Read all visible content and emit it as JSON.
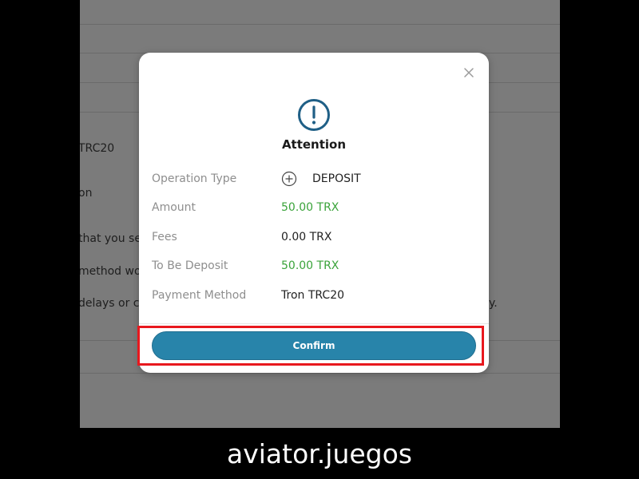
{
  "background": {
    "fragments": [
      "TRC20",
      "on",
      "that you se",
      "method wo",
      "delays or c",
      "y."
    ]
  },
  "modal": {
    "title": "Attention",
    "icons": {
      "close": "close-icon",
      "alert": "exclamation-circle-icon",
      "plus": "plus-circle-icon"
    },
    "rows": [
      {
        "label": "Operation Type",
        "value": "DEPOSIT"
      },
      {
        "label": "Amount",
        "value": "50.00 TRX"
      },
      {
        "label": "Fees",
        "value": "0.00 TRX"
      },
      {
        "label": "To Be Deposit",
        "value": "50.00 TRX"
      },
      {
        "label": "Payment Method",
        "value": "Tron TRC20"
      }
    ],
    "confirm_label": "Confirm"
  },
  "watermark": "aviator.juegos",
  "colors": {
    "accent": "#2884aa",
    "green_value": "#3aa33a",
    "highlight": "#e8181e",
    "icon_blue": "#1f5f86"
  }
}
